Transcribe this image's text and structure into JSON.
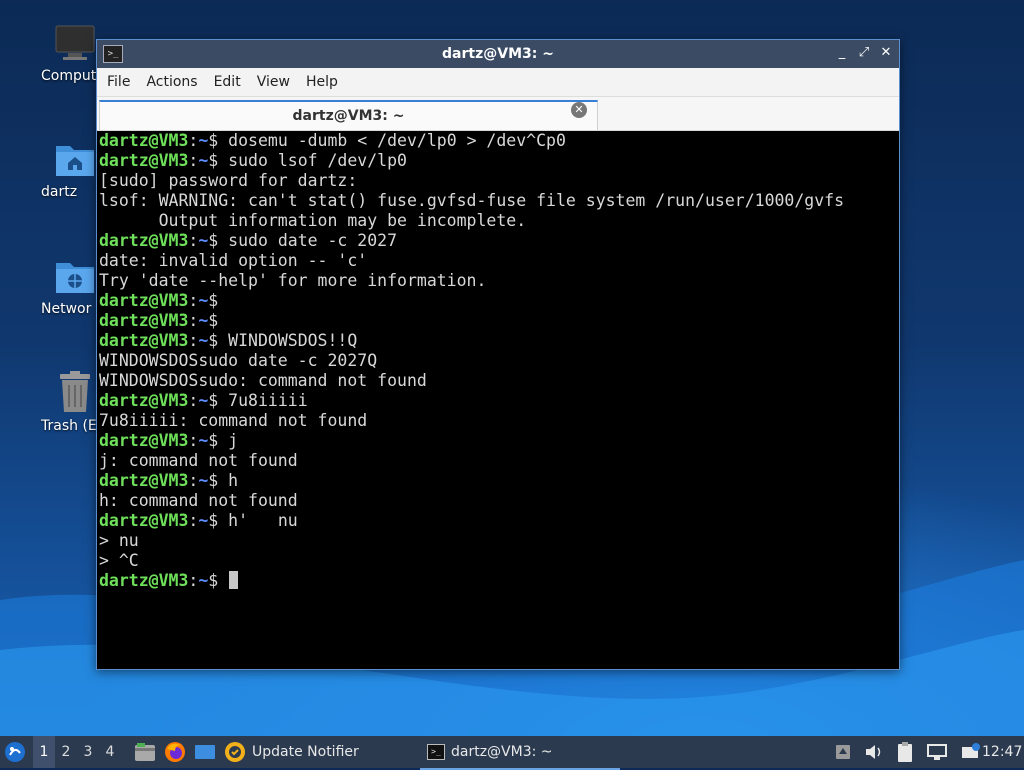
{
  "desktop": {
    "icons": [
      {
        "label": "Comput"
      },
      {
        "label": "dartz"
      },
      {
        "label": "Networ"
      },
      {
        "label": "Trash (Em"
      }
    ]
  },
  "window": {
    "title": "dartz@VM3: ~",
    "menu": [
      "File",
      "Actions",
      "Edit",
      "View",
      "Help"
    ],
    "tab_title": "dartz@VM3: ~",
    "buttons": {
      "minimize": "_",
      "maximize": "⤢",
      "close": "✕"
    }
  },
  "terminal": {
    "prompt_user": "dartz@VM3",
    "prompt_sep": ":",
    "prompt_path": "~",
    "prompt_sigil": "$ ",
    "lines": [
      {
        "prompt": true,
        "text": "dosemu -dumb < /dev/lp0 > /dev^Cp0"
      },
      {
        "prompt": true,
        "text": "sudo lsof /dev/lp0"
      },
      {
        "prompt": false,
        "text": "[sudo] password for dartz:"
      },
      {
        "prompt": false,
        "text": "lsof: WARNING: can't stat() fuse.gvfsd-fuse file system /run/user/1000/gvfs"
      },
      {
        "prompt": false,
        "text": "      Output information may be incomplete."
      },
      {
        "prompt": true,
        "text": "sudo date -c 2027"
      },
      {
        "prompt": false,
        "text": "date: invalid option -- 'c'"
      },
      {
        "prompt": false,
        "text": "Try 'date --help' for more information."
      },
      {
        "prompt": true,
        "text": ""
      },
      {
        "prompt": true,
        "text": ""
      },
      {
        "prompt": true,
        "text": "WINDOWSDOS!!Q"
      },
      {
        "prompt": false,
        "text": "WINDOWSDOSsudo date -c 2027Q"
      },
      {
        "prompt": false,
        "text": "WINDOWSDOSsudo: command not found"
      },
      {
        "prompt": true,
        "text": "7u8iiiii"
      },
      {
        "prompt": false,
        "text": "7u8iiiii: command not found"
      },
      {
        "prompt": true,
        "text": "j"
      },
      {
        "prompt": false,
        "text": "j: command not found"
      },
      {
        "prompt": true,
        "text": "h"
      },
      {
        "prompt": false,
        "text": "h: command not found"
      },
      {
        "prompt": true,
        "text": "h'   nu"
      },
      {
        "prompt": false,
        "text": "> nu"
      },
      {
        "prompt": false,
        "text": "> ^C"
      },
      {
        "prompt": true,
        "text": "",
        "cursor": true
      }
    ]
  },
  "taskbar": {
    "workspaces": [
      "1",
      "2",
      "3",
      "4"
    ],
    "active_workspace": "1",
    "apps": [
      {
        "label": "Update Notifier"
      },
      {
        "label": "dartz@VM3: ~"
      }
    ],
    "clock": "12:47"
  }
}
